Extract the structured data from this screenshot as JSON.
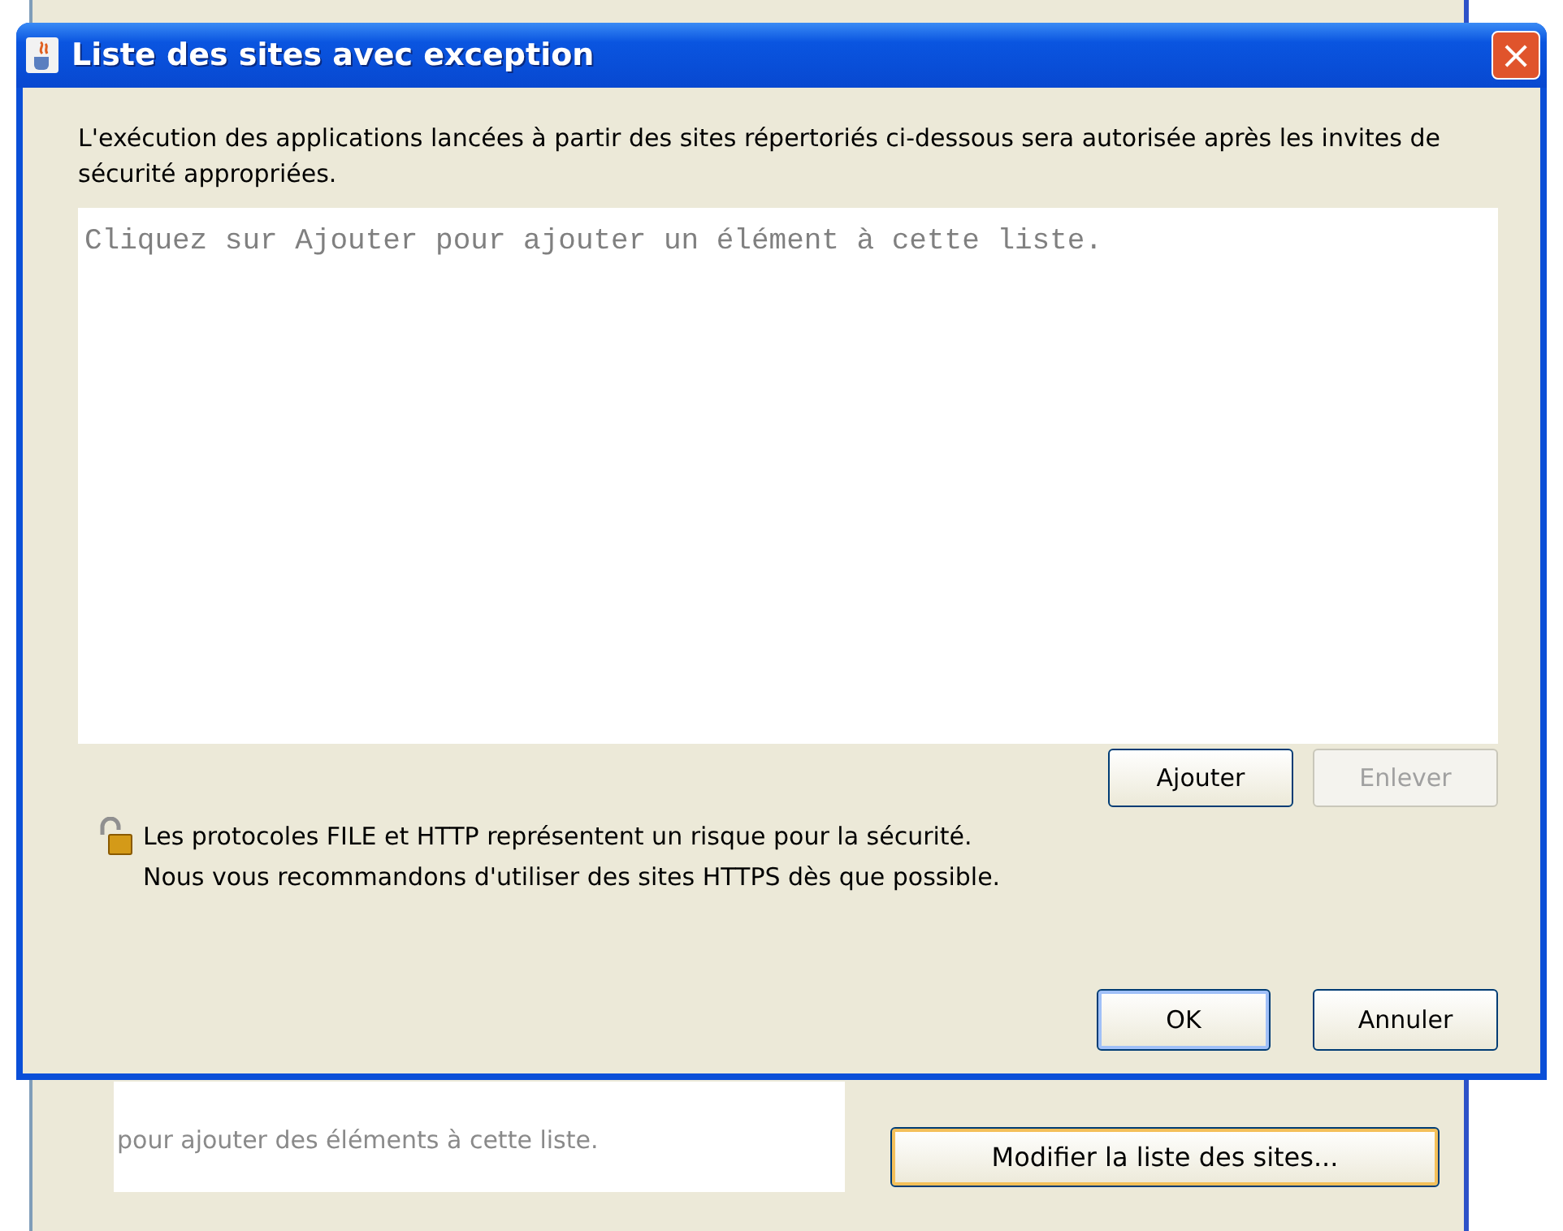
{
  "background_window": {
    "list_hint": "pour ajouter des éléments à cette liste.",
    "edit_button": "Modifier la liste des sites..."
  },
  "dialog": {
    "title": "Liste des sites avec exception",
    "close": "×",
    "description": "L'exécution des applications lancées à partir des sites répertoriés ci-dessous sera autorisée après les invites de sécurité appropriées.",
    "list_placeholder": "Cliquez sur Ajouter pour ajouter un élément à cette liste.",
    "list_buttons": [
      {
        "label": "Ajouter",
        "disabled": false
      },
      {
        "label": "Enlever",
        "disabled": true
      }
    ],
    "warning": [
      "Les protocoles FILE et HTTP représentent un risque pour la sécurité.",
      "Nous vous recommandons d'utiliser des sites HTTPS dès que possible."
    ],
    "buttons": [
      {
        "label": "OK",
        "default": true
      },
      {
        "label": "Annuler",
        "default": false
      }
    ]
  }
}
